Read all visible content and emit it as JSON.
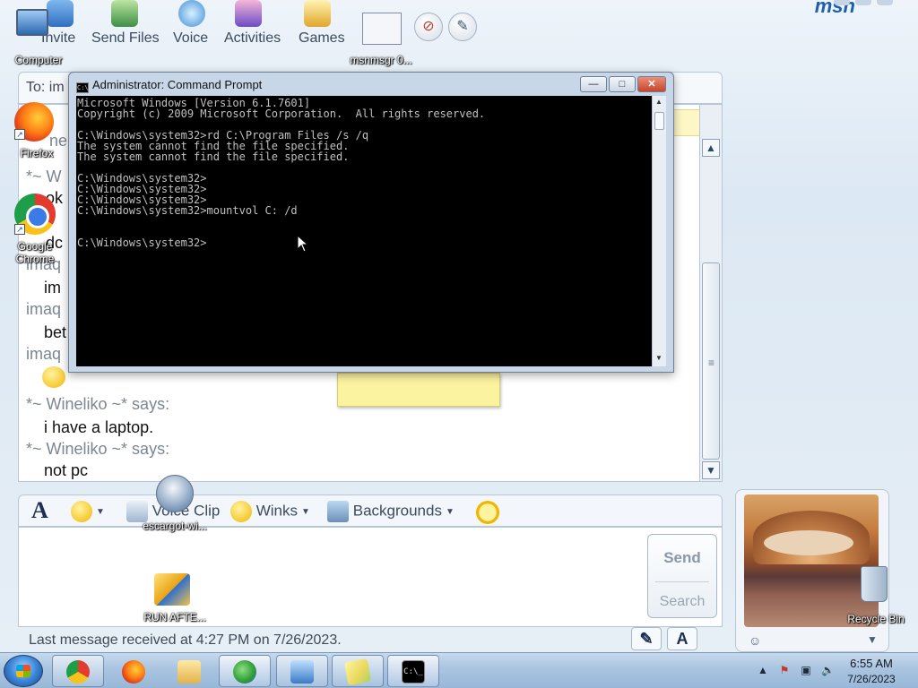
{
  "brand": "msn",
  "toolbar": {
    "items": [
      {
        "label": "Invite"
      },
      {
        "label": "Send Files"
      },
      {
        "label": "Voice"
      },
      {
        "label": "Activities"
      },
      {
        "label": "Games"
      }
    ]
  },
  "to": {
    "label": "To: im"
  },
  "conversation": {
    "lines": [
      {
        "kind": "sender",
        "text": "*~ Wineliko ~* says:"
      },
      {
        "kind": "msg",
        "text": "i have a laptop."
      },
      {
        "kind": "sender",
        "text": "*~ Wineliko ~* says:"
      },
      {
        "kind": "msg",
        "text": "not pc"
      }
    ],
    "partial": [
      "ne",
      "*~ W",
      "ok",
      "dc",
      "imaq",
      "im",
      "imaq",
      "bet",
      "imaq"
    ]
  },
  "format_bar": {
    "font_label": "A",
    "voice_clip": "Voice Clip",
    "winks": "Winks",
    "backgrounds": "Backgrounds"
  },
  "send_panel": {
    "send": "Send",
    "search": "Search"
  },
  "status": {
    "text": "Last message received at 4:27 PM on 7/26/2023."
  },
  "font_button": "A",
  "desktop_icons": [
    {
      "label": "Computer",
      "icon": "computer-icon"
    },
    {
      "label": "msnmsgr 0...",
      "icon": "screenshot-file-icon"
    },
    {
      "label": "Firefox",
      "icon": "firefox-icon"
    },
    {
      "label": "Google Chrome",
      "icon": "chrome-icon"
    },
    {
      "label": "escargot-wi...",
      "icon": "installer-icon"
    },
    {
      "label": "RUN AFTE...",
      "icon": "shortcut-shield-icon"
    },
    {
      "label": "Recycle Bin",
      "icon": "recycle-bin-icon"
    }
  ],
  "cmd": {
    "title": "Administrator: Command Prompt",
    "output": "Microsoft Windows [Version 6.1.7601]\nCopyright (c) 2009 Microsoft Corporation.  All rights reserved.\n\nC:\\Windows\\system32>rd C:\\Program Files /s /q\nThe system cannot find the file specified.\nThe system cannot find the file specified.\n\nC:\\Windows\\system32>\nC:\\Windows\\system32>\nC:\\Windows\\system32>\nC:\\Windows\\system32>mountvol C: /d\n\n\nC:\\Windows\\system32>"
  },
  "taskbar": {
    "apps": [
      "chrome-icon",
      "firefox-icon",
      "folder-icon",
      "messenger-icon",
      "picture-icon",
      "sticky-notes-icon",
      "cmd-icon"
    ],
    "clock_time": "6:55 AM",
    "clock_date": "7/26/2023"
  },
  "colors": {
    "taskbar": "#a9c4e0",
    "accent": "#1f5fb0",
    "console_bg": "#000000",
    "console_fg": "#c0c0c0"
  }
}
